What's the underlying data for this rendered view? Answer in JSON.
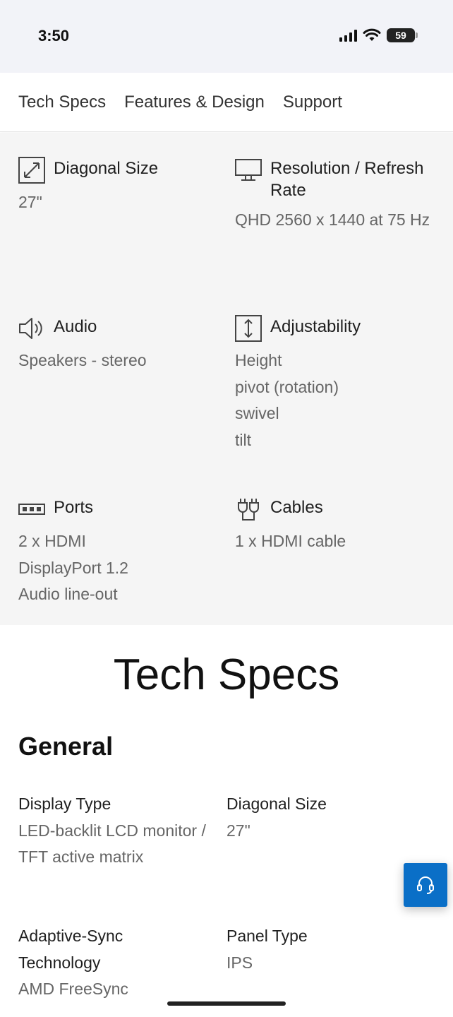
{
  "status_bar": {
    "time": "3:50",
    "battery": "59"
  },
  "tabs": [
    "Tech Specs",
    "Features & Design",
    "Support"
  ],
  "highlights": [
    {
      "title": "Diagonal Size",
      "icon": "diagonal-size-icon",
      "values": [
        "27\""
      ]
    },
    {
      "title": "Resolution / Refresh Rate",
      "icon": "monitor-icon",
      "values": [
        "QHD 2560 x 1440 at 75 Hz"
      ]
    },
    {
      "title": "Audio",
      "icon": "speaker-icon",
      "values": [
        "Speakers - stereo"
      ]
    },
    {
      "title": "Adjustability",
      "icon": "adjustability-icon",
      "values": [
        "Height",
        "pivot (rotation)",
        "swivel",
        "tilt"
      ]
    },
    {
      "title": "Ports",
      "icon": "ports-icon",
      "values": [
        "2 x HDMI",
        "DisplayPort 1.2",
        "Audio line-out"
      ]
    },
    {
      "title": "Cables",
      "icon": "cable-icon",
      "values": [
        "1 x HDMI cable"
      ]
    }
  ],
  "tech_specs": {
    "title": "Tech Specs",
    "section": "General",
    "items": [
      {
        "label": "Display Type",
        "value": "LED-backlit LCD monitor / TFT active matrix"
      },
      {
        "label": "Diagonal Size",
        "value": "27\""
      },
      {
        "label": "Adaptive-Sync Technology",
        "value": "AMD FreeSync"
      },
      {
        "label": "Panel Type",
        "value": "IPS"
      }
    ]
  },
  "chat_button": {
    "icon": "headset-icon"
  }
}
